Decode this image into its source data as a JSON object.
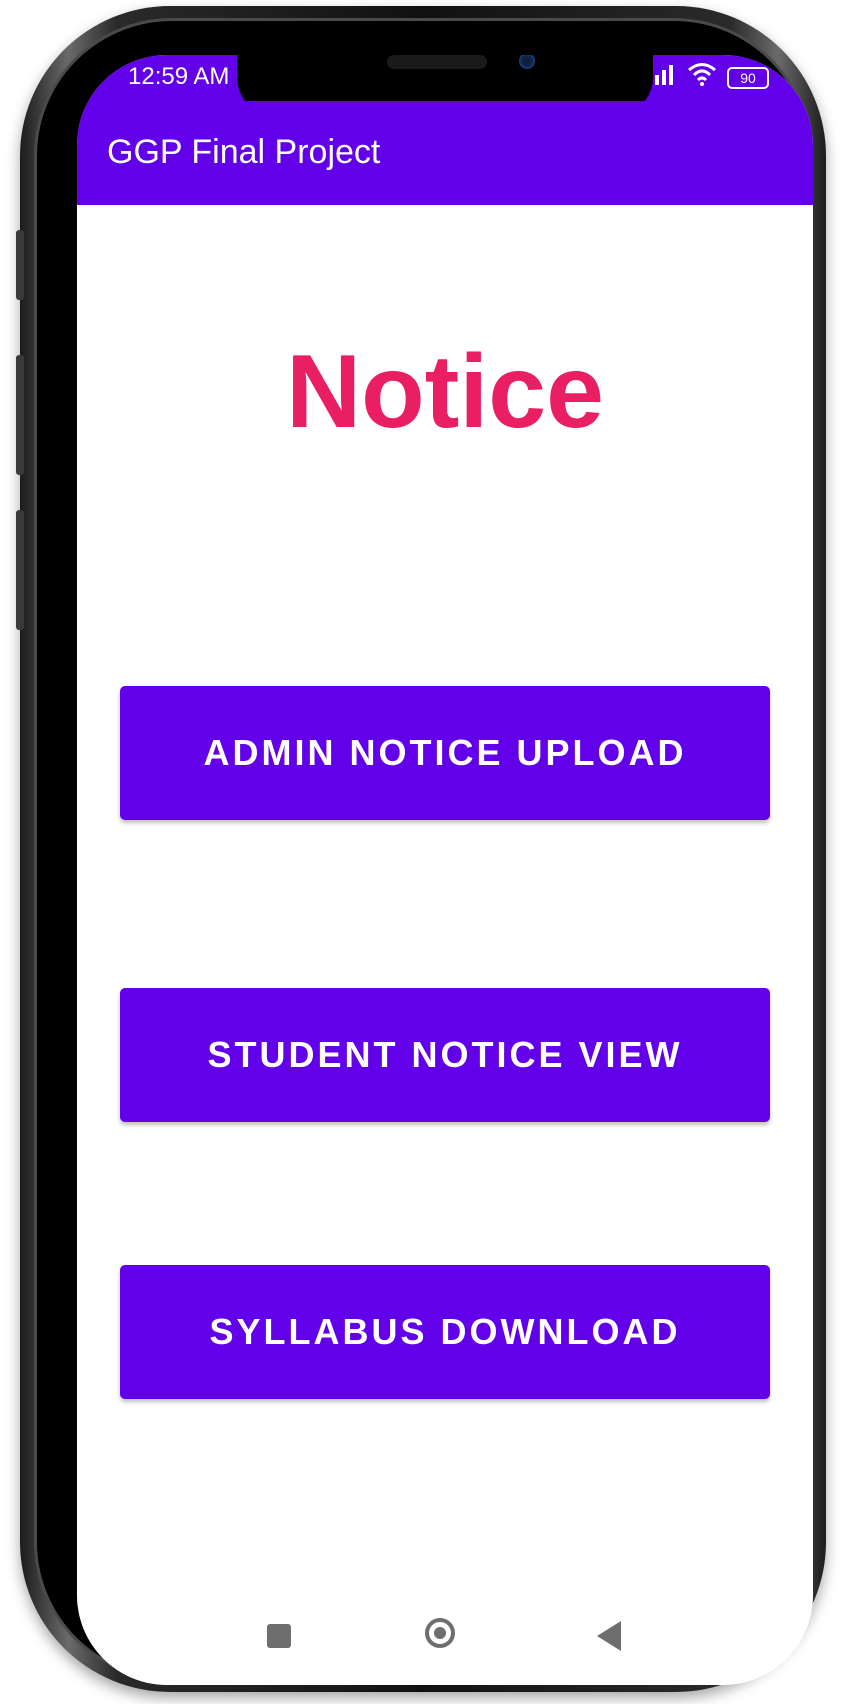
{
  "status_bar": {
    "time": "12:59 AM",
    "battery": "90"
  },
  "app_bar": {
    "title": "GGP Final Project"
  },
  "main": {
    "heading": "Notice",
    "buttons": [
      {
        "label": "ADMIN NOTICE UPLOAD"
      },
      {
        "label": "STUDENT NOTICE VIEW"
      },
      {
        "label": "SYLLABUS DOWNLOAD"
      }
    ]
  },
  "colors": {
    "primary": "#6200ea",
    "heading": "#e91e63"
  },
  "nav_bar": {
    "icons": [
      "recents-square-icon",
      "home-circle-icon",
      "back-triangle-icon"
    ]
  }
}
